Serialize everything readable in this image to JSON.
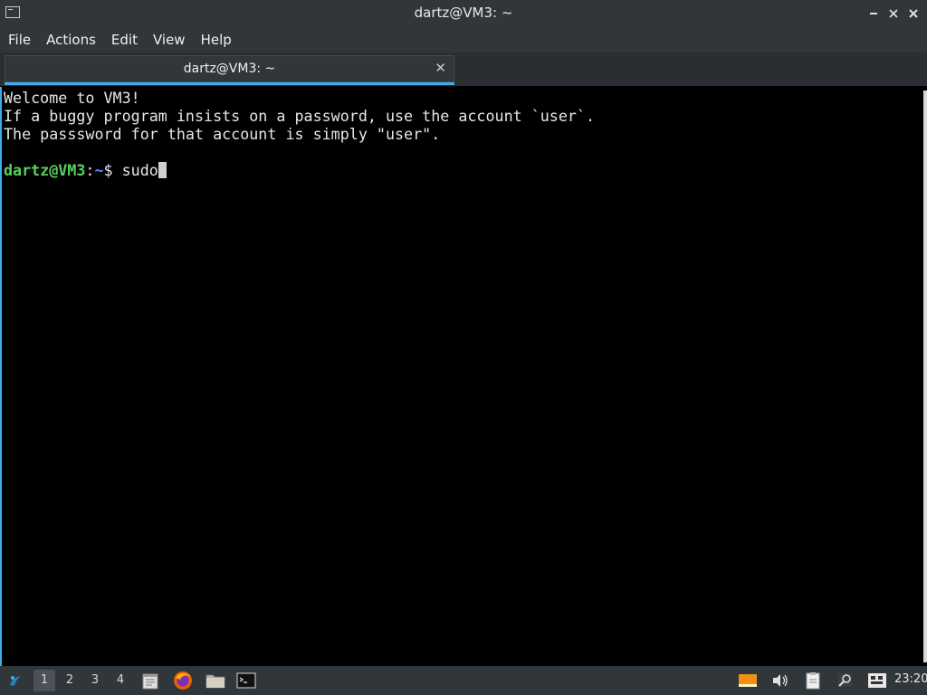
{
  "window": {
    "title": "dartz@VM3: ~"
  },
  "menu": [
    "File",
    "Actions",
    "Edit",
    "View",
    "Help"
  ],
  "tab": {
    "label": "dartz@VM3: ~",
    "close": "✕"
  },
  "terminal": {
    "lines": [
      "Welcome to VM3!",
      "If a buggy program insists on a password, use the account `user`.",
      "The passsword for that account is simply \"user\"."
    ],
    "prompt_user": "dartz@VM3",
    "prompt_sep": ":",
    "prompt_path": "~",
    "prompt_symbol": "$ ",
    "command": "sudo"
  },
  "taskbar": {
    "workspaces": [
      "1",
      "2",
      "3",
      "4"
    ],
    "active_workspace": "1",
    "apps": [
      "notes-icon",
      "firefox-icon",
      "file-manager-icon",
      "terminal-icon"
    ],
    "tray": [
      "orange-indicator-icon",
      "volume-icon",
      "clipboard-icon",
      "search-icon",
      "keyboard-layout-icon"
    ],
    "clock": "23:20"
  },
  "colors": {
    "accent": "#3daee9",
    "prompt_user": "#58d05a",
    "prompt_path": "#5b8ef0",
    "chrome": "#31363b"
  }
}
